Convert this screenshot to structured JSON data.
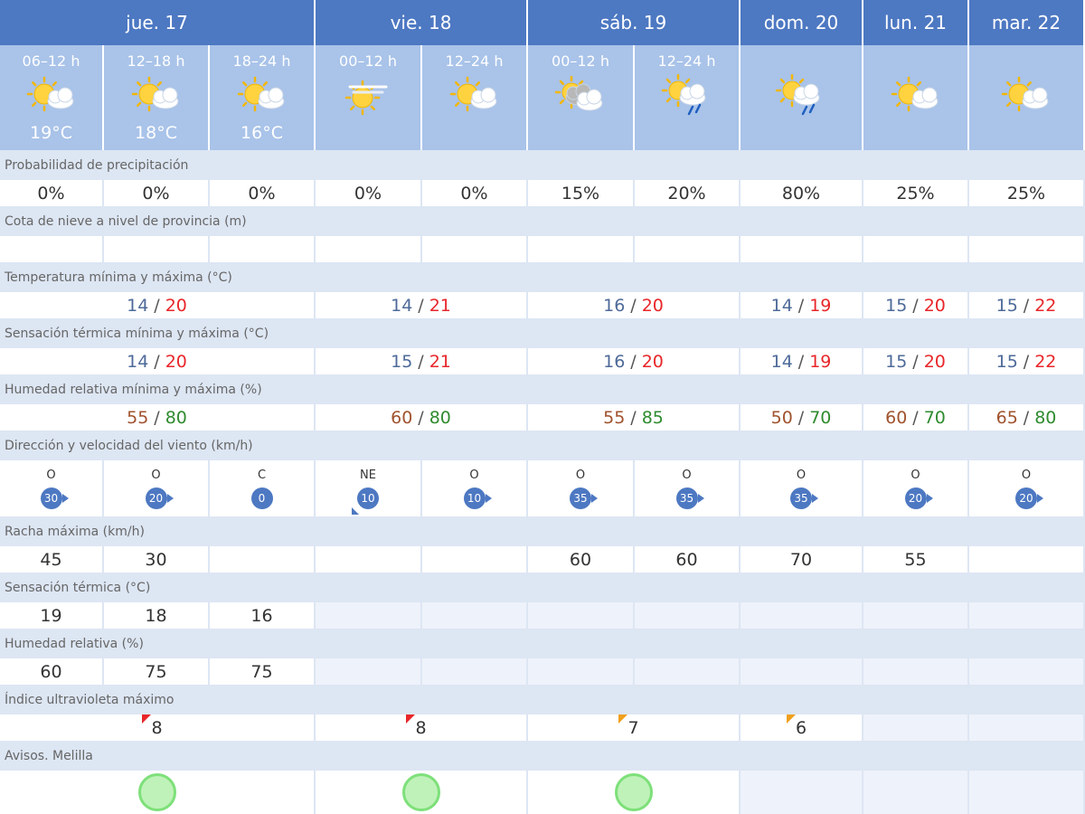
{
  "days": [
    {
      "label": "jue. 17",
      "span": 3
    },
    {
      "label": "vie. 18",
      "span": 2
    },
    {
      "label": "sáb. 19",
      "span": 2
    },
    {
      "label": "dom. 20",
      "span": 1
    },
    {
      "label": "lun. 21",
      "span": 1
    },
    {
      "label": "mar. 22",
      "span": 1
    }
  ],
  "periods": [
    {
      "label": "06–12 h",
      "icon": "sun-cloud-icon",
      "temp": "19°C"
    },
    {
      "label": "12–18 h",
      "icon": "sun-cloud-icon",
      "temp": "18°C"
    },
    {
      "label": "18–24 h",
      "icon": "sun-cloud-icon",
      "temp": "16°C"
    },
    {
      "label": "00–12 h",
      "icon": "sun-haze-icon",
      "temp": ""
    },
    {
      "label": "12–24 h",
      "icon": "sun-cloud-icon",
      "temp": ""
    },
    {
      "label": "00–12 h",
      "icon": "sun-clouds-gray-icon",
      "temp": ""
    },
    {
      "label": "12–24 h",
      "icon": "sun-rain-icon",
      "temp": ""
    },
    {
      "label": "",
      "icon": "sun-rain-icon",
      "temp": ""
    },
    {
      "label": "",
      "icon": "sun-cloud-icon",
      "temp": ""
    },
    {
      "label": "",
      "icon": "sun-cloud-icon",
      "temp": ""
    }
  ],
  "labels": {
    "precip": "Probabilidad de precipitación",
    "snow": "Cota de nieve a nivel de provincia (m)",
    "temp": "Temperatura mínima y máxima (°C)",
    "feels": "Sensación térmica mínima y máxima (°C)",
    "humid": "Humedad relativa mínima y máxima (%)",
    "wind": "Dirección y velocidad del viento (km/h)",
    "gust": "Racha máxima (km/h)",
    "feels_period": "Sensación térmica (°C)",
    "humid_period": "Humedad relativa (%)",
    "uv": "Índice ultravioleta máximo",
    "avisos": "Avisos. Melilla"
  },
  "precip": [
    "0%",
    "0%",
    "0%",
    "0%",
    "0%",
    "15%",
    "20%",
    "80%",
    "25%",
    "25%"
  ],
  "snow": [
    "",
    "",
    "",
    "",
    "",
    "",
    "",
    "",
    "",
    ""
  ],
  "temp_minmax": [
    {
      "min": "14",
      "max": "20"
    },
    {
      "min": "14",
      "max": "21"
    },
    {
      "min": "16",
      "max": "20"
    },
    {
      "min": "14",
      "max": "19"
    },
    {
      "min": "15",
      "max": "20"
    },
    {
      "min": "15",
      "max": "22"
    }
  ],
  "feels_minmax": [
    {
      "min": "14",
      "max": "20"
    },
    {
      "min": "15",
      "max": "21"
    },
    {
      "min": "16",
      "max": "20"
    },
    {
      "min": "14",
      "max": "19"
    },
    {
      "min": "15",
      "max": "20"
    },
    {
      "min": "15",
      "max": "22"
    }
  ],
  "humid_minmax": [
    {
      "min": "55",
      "max": "80"
    },
    {
      "min": "60",
      "max": "80"
    },
    {
      "min": "55",
      "max": "85"
    },
    {
      "min": "50",
      "max": "70"
    },
    {
      "min": "60",
      "max": "70"
    },
    {
      "min": "65",
      "max": "80"
    }
  ],
  "separator": "/",
  "wind": [
    {
      "dir": "O",
      "speed": "30",
      "arrow": "east"
    },
    {
      "dir": "O",
      "speed": "20",
      "arrow": "east"
    },
    {
      "dir": "C",
      "speed": "0",
      "arrow": "none"
    },
    {
      "dir": "NE",
      "speed": "10",
      "arrow": "southwest"
    },
    {
      "dir": "O",
      "speed": "10",
      "arrow": "east"
    },
    {
      "dir": "O",
      "speed": "35",
      "arrow": "east"
    },
    {
      "dir": "O",
      "speed": "35",
      "arrow": "east"
    },
    {
      "dir": "O",
      "speed": "35",
      "arrow": "east"
    },
    {
      "dir": "O",
      "speed": "20",
      "arrow": "east"
    },
    {
      "dir": "O",
      "speed": "20",
      "arrow": "east"
    }
  ],
  "gust": [
    "45",
    "30",
    "",
    "",
    "",
    "60",
    "60",
    "70",
    "55",
    ""
  ],
  "feels_period": [
    "19",
    "18",
    "16"
  ],
  "humid_period": [
    "60",
    "75",
    "75"
  ],
  "uv": [
    {
      "value": "8",
      "color": "#e8262a"
    },
    {
      "value": "8",
      "color": "#e8262a"
    },
    {
      "value": "7",
      "color": "#f0a01e"
    },
    {
      "value": "6",
      "color": "#f0a01e"
    },
    {
      "value": "",
      "color": ""
    },
    {
      "value": "",
      "color": ""
    }
  ],
  "avisos": [
    {
      "level": "green",
      "color": "#bff2b9"
    },
    {
      "level": "green",
      "color": "#bff2b9"
    },
    {
      "level": "green",
      "color": "#bff2b9"
    },
    {
      "level": "",
      "color": ""
    },
    {
      "level": "",
      "color": ""
    },
    {
      "level": "",
      "color": ""
    }
  ],
  "colors": {
    "header": "#4d78c2",
    "period": "#a9c3e9",
    "label_row": "#dde6f3",
    "tmax": "#e8262a",
    "hmax": "#2e8b2e",
    "hmin": "#a0522d"
  }
}
